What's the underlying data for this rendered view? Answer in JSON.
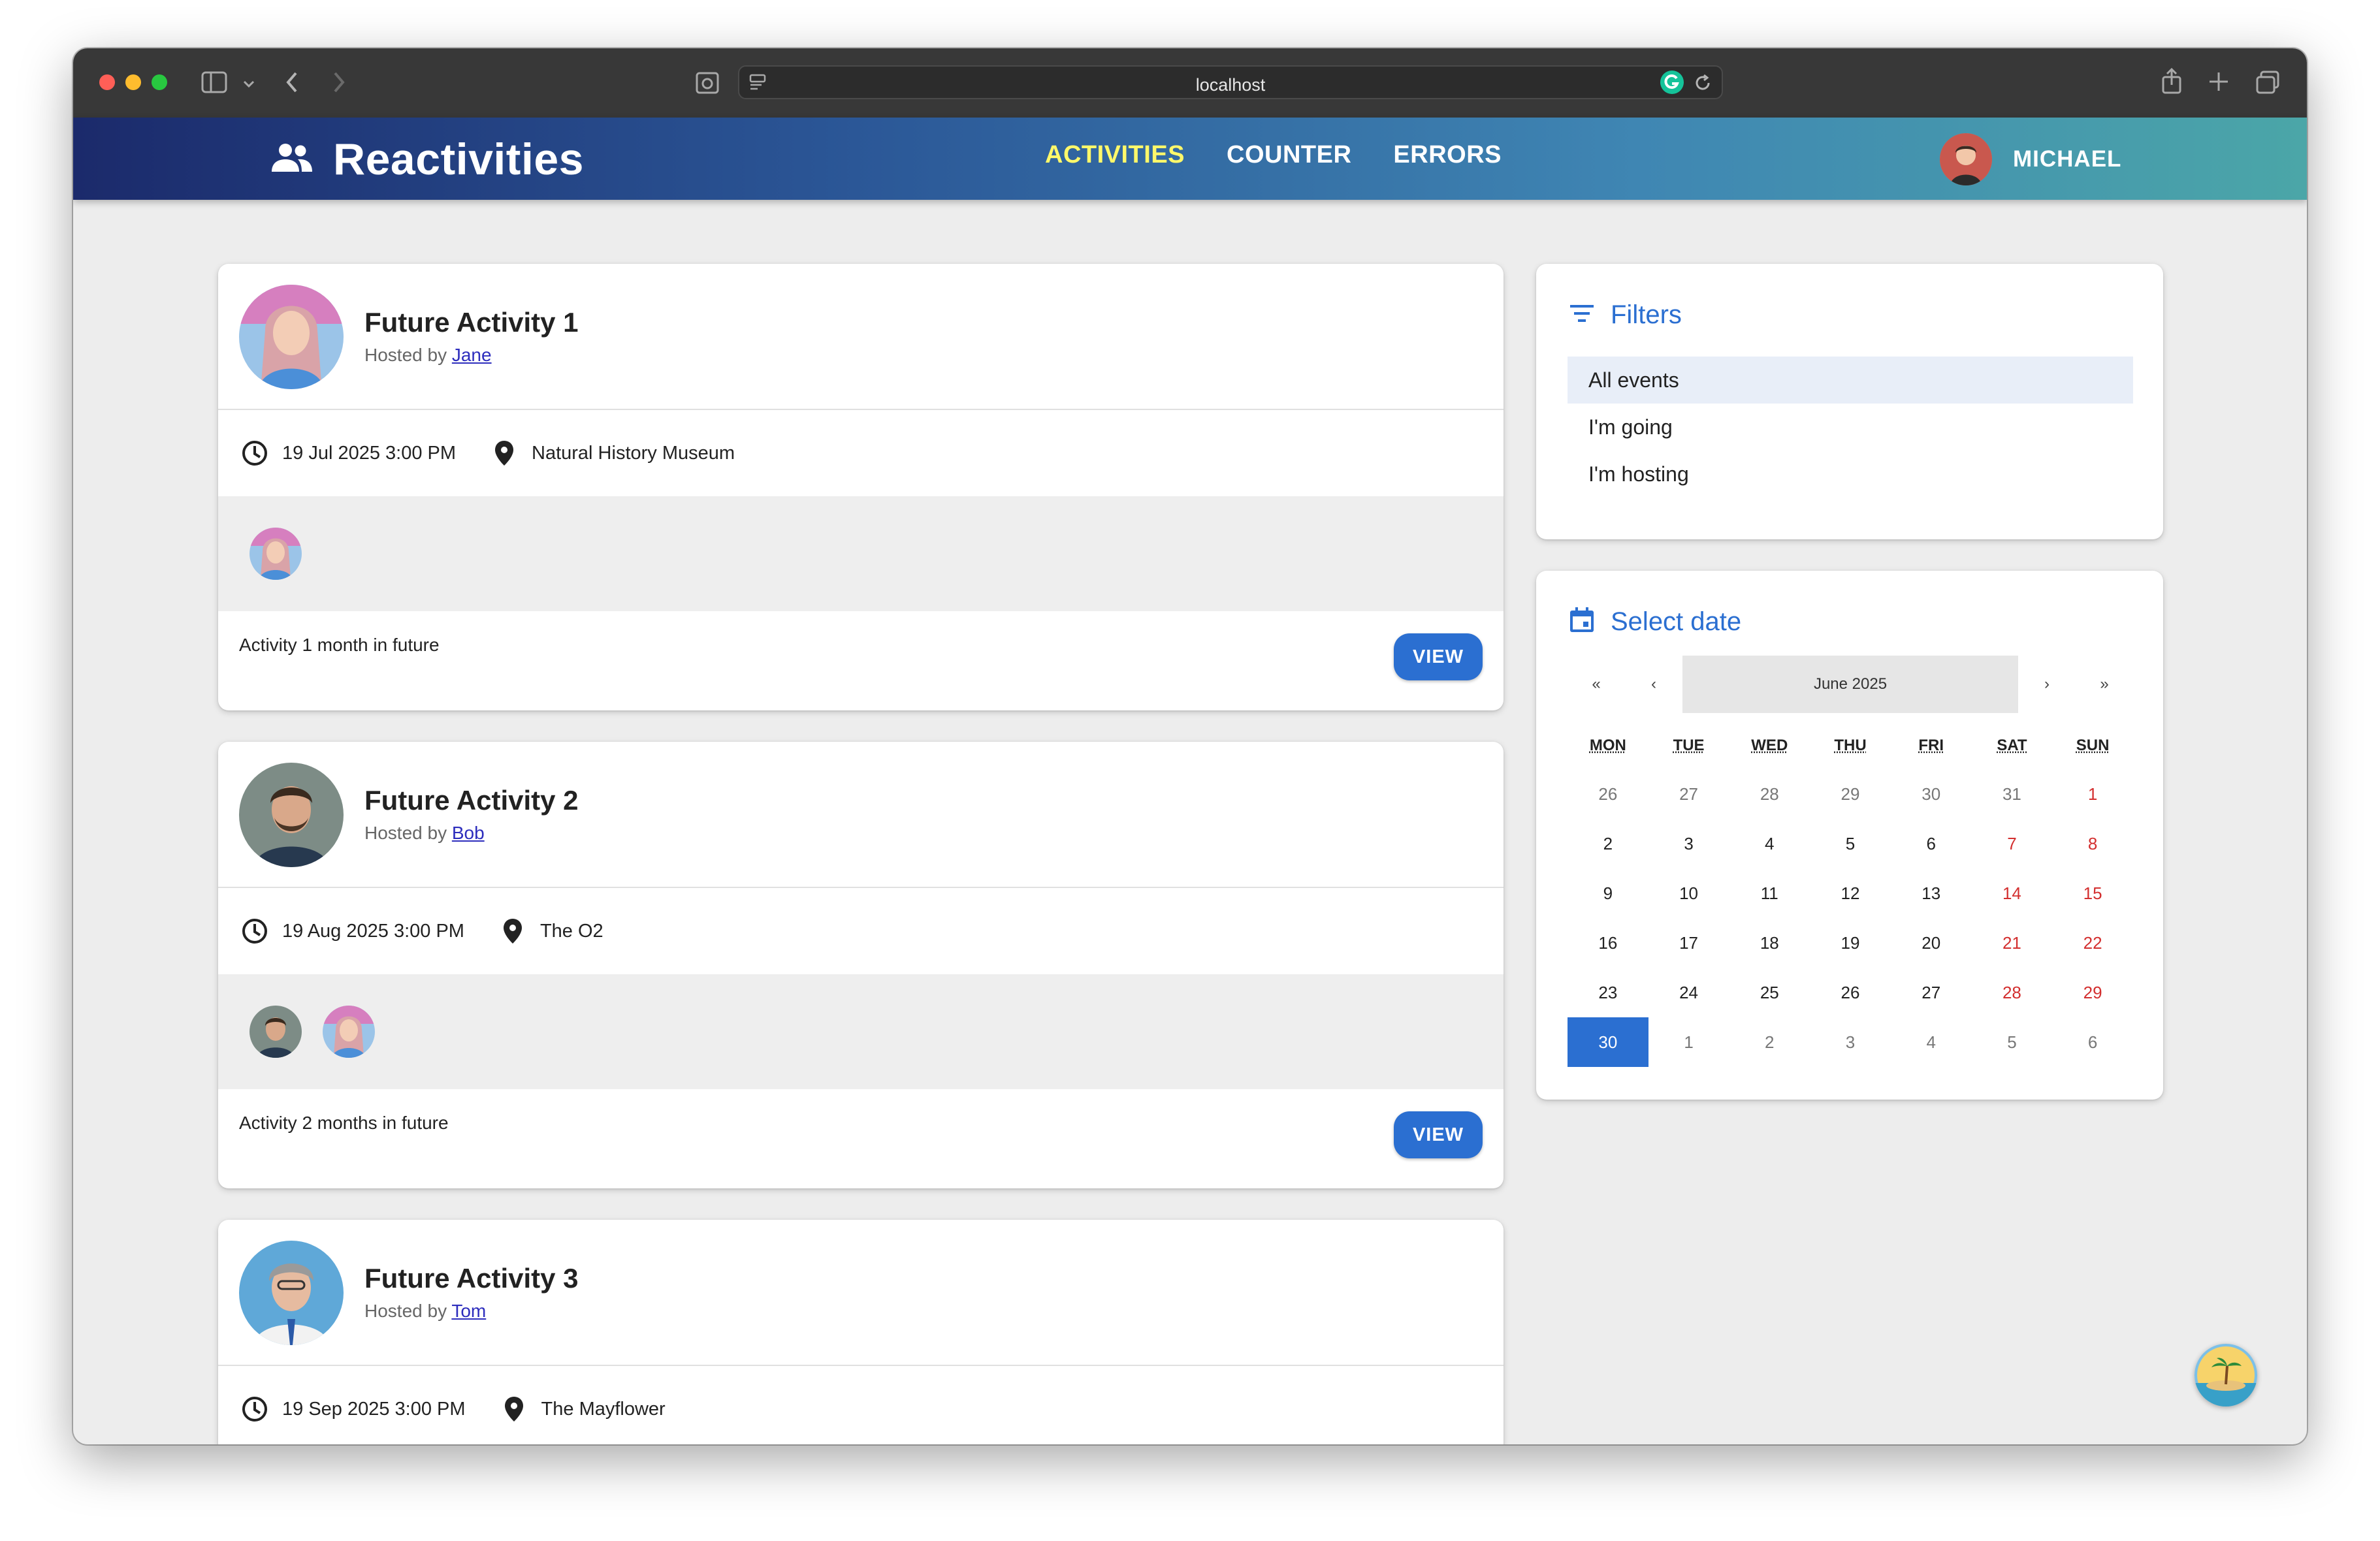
{
  "browser": {
    "url": "localhost"
  },
  "appbar": {
    "brand": "Reactivities",
    "nav": [
      "Activities",
      "Counter",
      "Errors"
    ],
    "active_nav": "Activities",
    "user_name": "MICHAEL"
  },
  "activities": [
    {
      "title": "Future Activity 1",
      "hosted_by_prefix": "Hosted by ",
      "host": "Jane",
      "date": "19 Jul 2025 3:00 PM",
      "venue": "Natural History Museum",
      "attendees": [
        "Jane"
      ],
      "description": "Activity 1 month in future",
      "view_label": "VIEW"
    },
    {
      "title": "Future Activity 2",
      "hosted_by_prefix": "Hosted by ",
      "host": "Bob",
      "date": "19 Aug 2025 3:00 PM",
      "venue": "The O2",
      "attendees": [
        "Bob",
        "Jane"
      ],
      "description": "Activity 2 months in future",
      "view_label": "VIEW"
    },
    {
      "title": "Future Activity 3",
      "hosted_by_prefix": "Hosted by ",
      "host": "Tom",
      "date": "19 Sep 2025 3:00 PM",
      "venue": "The Mayflower"
    }
  ],
  "filters": {
    "title": "Filters",
    "items": [
      "All events",
      "I'm going",
      "I'm hosting"
    ],
    "selected": "All events"
  },
  "calendar": {
    "title": "Select date",
    "month_label": "June 2025",
    "nav": {
      "prev_year": "«",
      "prev_month": "‹",
      "next_month": "›",
      "next_year": "»"
    },
    "weekdays": [
      "MON",
      "TUE",
      "WED",
      "THU",
      "FRI",
      "SAT",
      "SUN"
    ],
    "weeks": [
      [
        "26",
        "27",
        "28",
        "29",
        "30",
        "31",
        "1"
      ],
      [
        "2",
        "3",
        "4",
        "5",
        "6",
        "7",
        "8"
      ],
      [
        "9",
        "10",
        "11",
        "12",
        "13",
        "14",
        "15"
      ],
      [
        "16",
        "17",
        "18",
        "19",
        "20",
        "21",
        "22"
      ],
      [
        "23",
        "24",
        "25",
        "26",
        "27",
        "28",
        "29"
      ],
      [
        "30",
        "1",
        "2",
        "3",
        "4",
        "5",
        "6"
      ]
    ],
    "selected_day": "30",
    "colors": {
      "accent": "#2b6fd1",
      "weekend": "#d32f2f"
    }
  }
}
